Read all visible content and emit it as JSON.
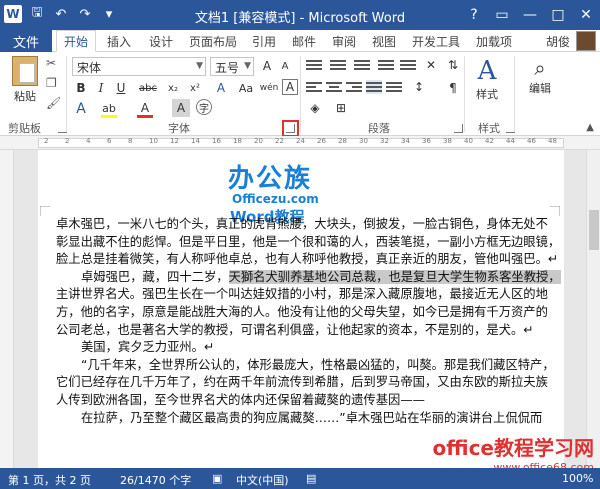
{
  "window": {
    "title": "文档1 [兼容模式] - Microsoft Word",
    "controls": [
      "?",
      "▭",
      "—",
      "□",
      "✕"
    ]
  },
  "tabs": [
    {
      "label": "文件"
    },
    {
      "label": "开始"
    },
    {
      "label": "插入"
    },
    {
      "label": "设计"
    },
    {
      "label": "页面布局"
    },
    {
      "label": "引用"
    },
    {
      "label": "邮件"
    },
    {
      "label": "审阅"
    },
    {
      "label": "视图"
    },
    {
      "label": "开发工具"
    },
    {
      "label": "加载项"
    }
  ],
  "user": {
    "name": "胡俊"
  },
  "ribbon": {
    "paste_label": "粘贴",
    "font_name": "宋体",
    "font_size": "五号",
    "style_label": "样式",
    "edit_label": "编辑",
    "groups": {
      "clipboard": "剪贴板",
      "font": "字体",
      "paragraph": "段落",
      "styles": "样式"
    },
    "buttons": {
      "bold": "B",
      "italic": "I",
      "underline": "U",
      "strike": "abc",
      "subscript": "x₂",
      "superscript": "x²",
      "grow": "A",
      "shrink": "A",
      "aa": "Aa",
      "clear": "A",
      "wen": "wén",
      "border_a": "A",
      "highlight": "ab",
      "fontcolor": "A",
      "shade": "A",
      "circle": "字"
    }
  },
  "ruler_ticks": [
    "2",
    "2",
    "4",
    "6",
    "8",
    "10",
    "12",
    "14",
    "16",
    "18",
    "20",
    "22",
    "24",
    "26",
    "28",
    "30",
    "32",
    "34",
    "36",
    "38",
    "40",
    "42",
    "44",
    "46",
    "48"
  ],
  "document": {
    "brand": {
      "line1": "办公族",
      "line2": "Officezu.com",
      "line3": "Word教程"
    },
    "lines": [
      {
        "text": "卓木强巴，一米八七的个头，真正的虎背熊腰，大块头，倒披发，一脸古铜色，身体无处不",
        "indent": false
      },
      {
        "text": "彰显出藏不住的彪悍。但是平日里，他是一个很和蔼的人，西装笔挺，一副小方框无边眼镜，",
        "indent": false
      },
      {
        "text": "脸上总是挂着微笑，有人称呼他卓总，也有人称呼他教授，真正亲近的朋友，管他叫强巴。↵",
        "indent": false
      },
      {
        "text_pre": "卓姆强巴，藏，四十二岁，",
        "text_hl": "天獅名犬驯养基地公司总裁，也是复旦大学生物系客坐教授，",
        "indent": true
      },
      {
        "text": "主讲世界名犬。强巴生长在一个叫达娃奴措的小村，那是深入藏原腹地，最接近无人区的地",
        "indent": false
      },
      {
        "text": "方，他的名字，原意是能战胜大海的人。他没有让他的父母失望，如今已是拥有千万资产的",
        "indent": false
      },
      {
        "text": "公司老总，也是著名大学的教授，可谓名利俱盛，让他起家的资本，不是别的，是犬。↵",
        "indent": false
      },
      {
        "text": "美国，宾夕乏力亚州。↵",
        "indent": true
      },
      {
        "text": "“几千年来，全世界所公认的，体形最庞大，性格最凶猛的，叫獒。那是我们藏区特产，",
        "indent": true
      },
      {
        "text": "它们已经存在几千万年了，约在两千年前流传到希腊，后到罗马帝国，又由东欧的斯拉夫族",
        "indent": false
      },
      {
        "text": "人传到欧洲各国，至今世界名犬的体内还保留着藏獒的遗传基因——",
        "indent": false
      },
      {
        "text": "在拉萨，乃至整个藏区最高贵的狗应属藏獒……”卓木强巴站在华丽的演讲台上侃侃而",
        "indent": true
      }
    ]
  },
  "status": {
    "page": "第 1 页，共 2 页",
    "words": "26/1470 个字",
    "language": "中文(中国)",
    "zoom": "100%"
  },
  "watermark": {
    "line1": "office教程学习网",
    "line2": "www.office68.com"
  }
}
